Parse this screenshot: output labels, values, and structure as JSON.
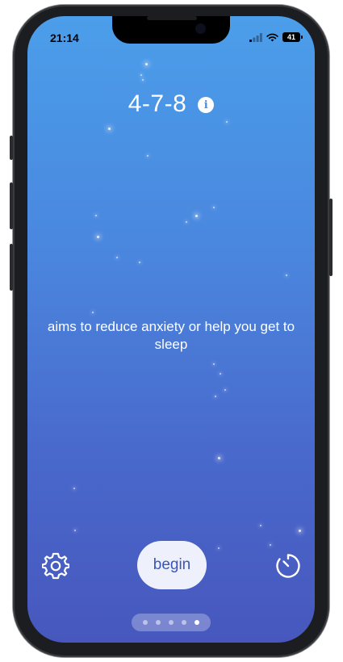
{
  "status_bar": {
    "time": "21:14",
    "battery": "41",
    "icons": [
      "signal-icon",
      "wifi-icon",
      "battery-icon"
    ]
  },
  "exercise": {
    "title": "4-7-8",
    "description": "aims to reduce anxiety or help you get to sleep"
  },
  "controls": {
    "begin_label": "begin",
    "settings_icon": "gear-icon",
    "timer_icon": "timer-icon",
    "info_icon": "info-icon"
  },
  "pager": {
    "total": 5,
    "active": 5
  },
  "colors": {
    "gradient_top": "#4b9eea",
    "gradient_bottom": "#4757bd",
    "button_bg": "#eef0fb",
    "button_text": "#3b56b8"
  }
}
